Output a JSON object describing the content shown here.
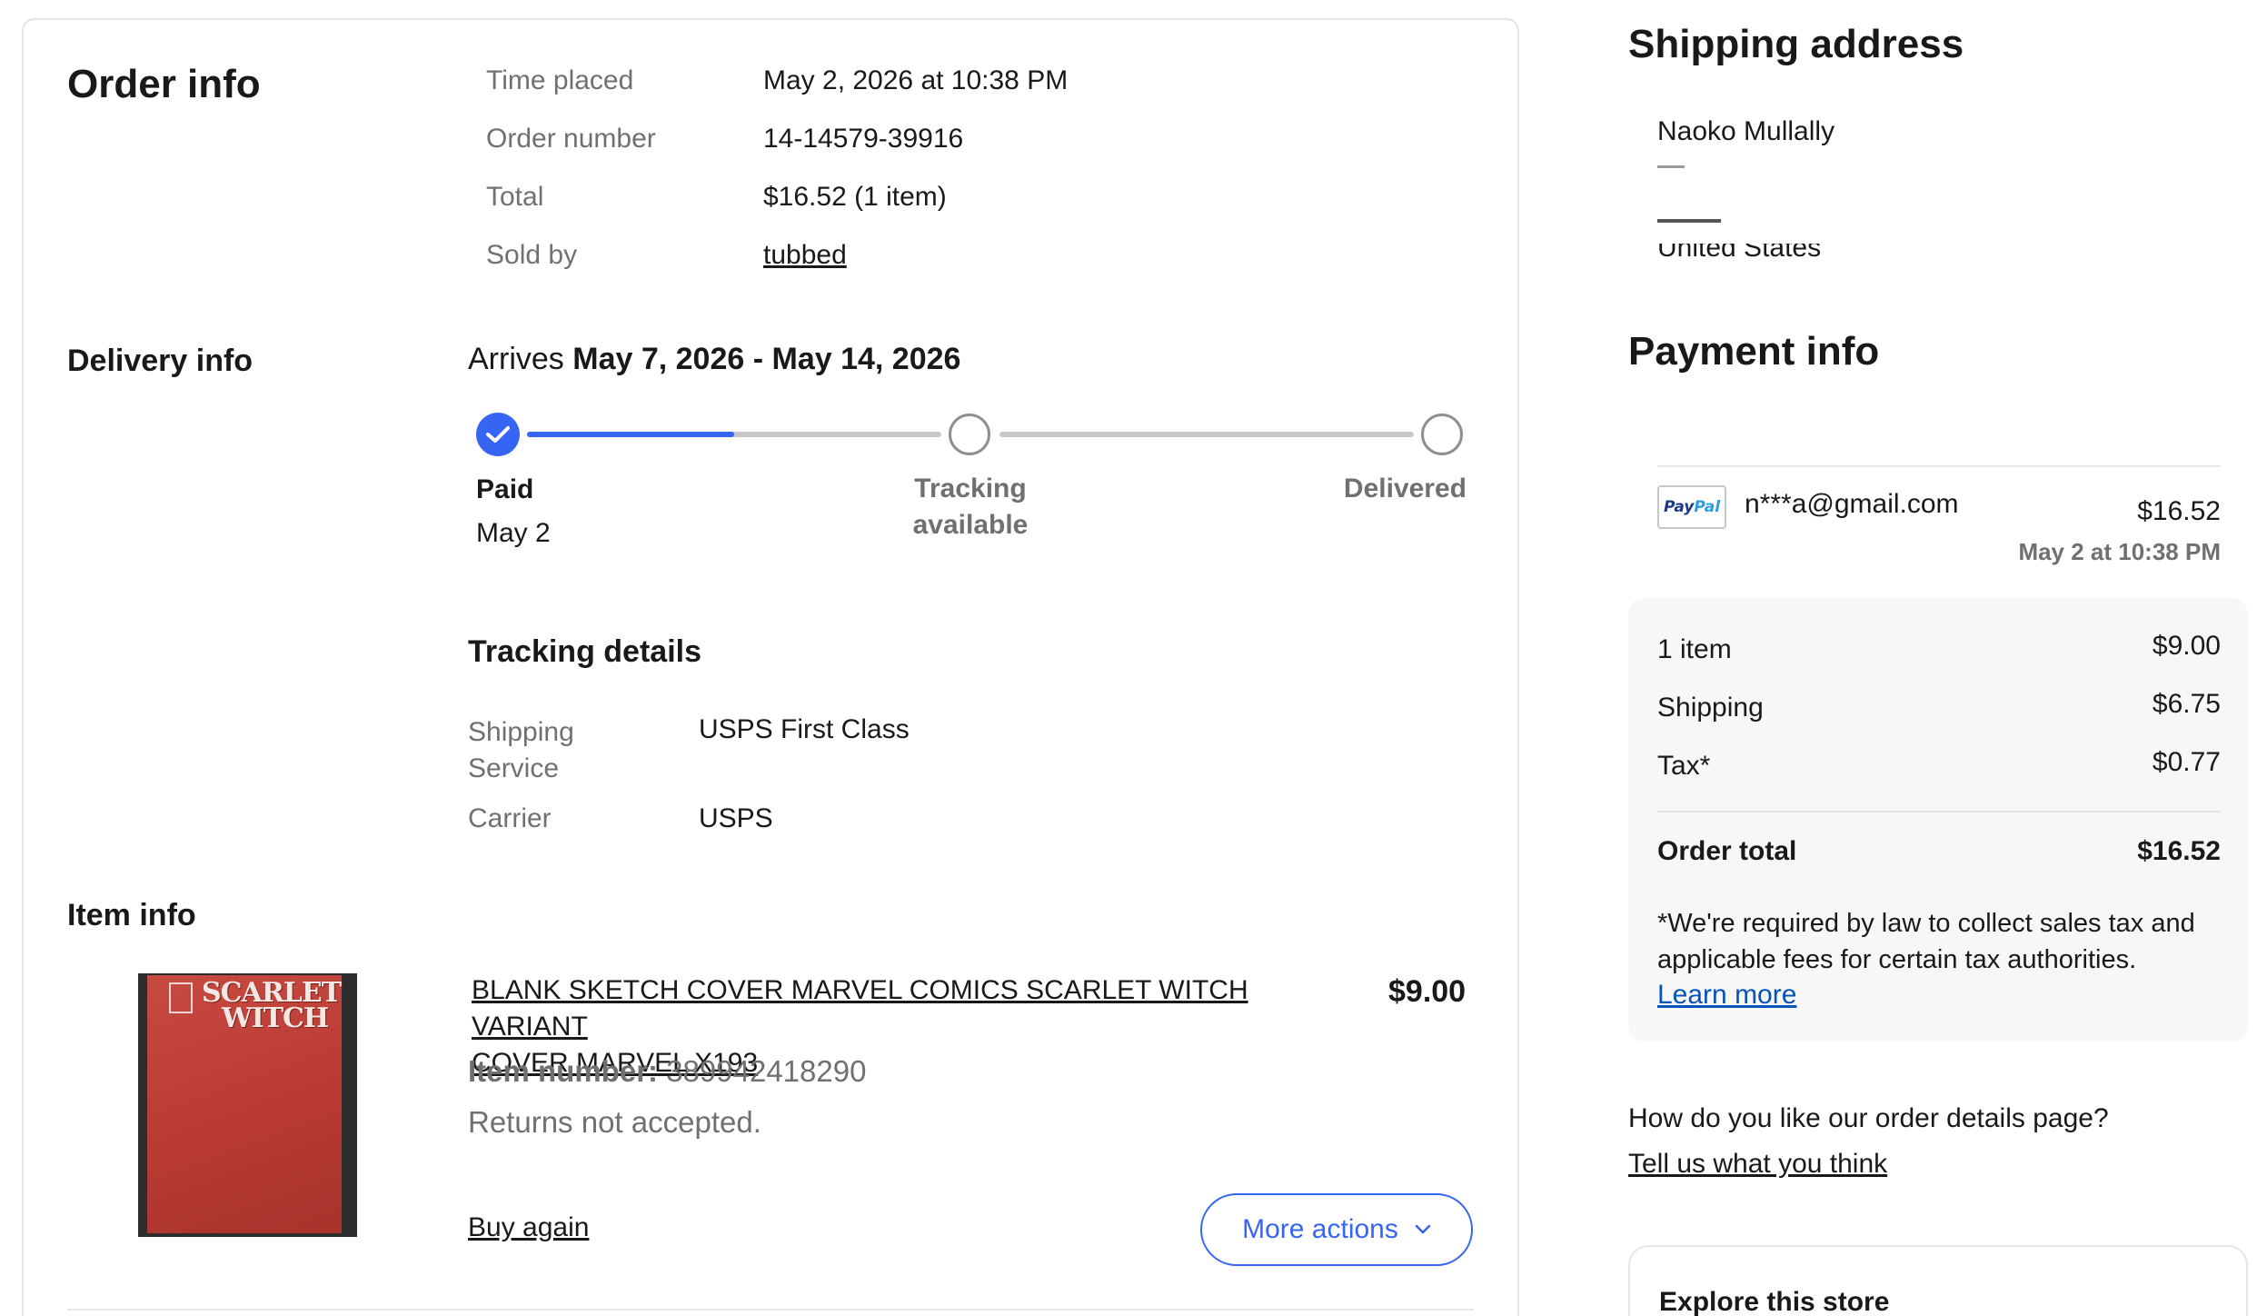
{
  "order_info": {
    "heading": "Order info",
    "rows": [
      {
        "label": "Time placed",
        "value": "May 2, 2026 at 10:38 PM"
      },
      {
        "label": "Order number",
        "value": "14-14579-39916"
      },
      {
        "label": "Total",
        "value": "$16.52 (1 item)"
      },
      {
        "label": "Sold by",
        "value": "tubbed"
      }
    ]
  },
  "delivery": {
    "heading": "Delivery info",
    "arrives_prefix": "Arrives",
    "arrives_range": "May 7, 2026 - May 14, 2026",
    "progress_fraction": 0.25,
    "steps": [
      {
        "label": "Paid",
        "sub": "May 2",
        "state": "done"
      },
      {
        "label_line1": "Tracking",
        "label_line2": "available",
        "state": "pending"
      },
      {
        "label": "Delivered",
        "state": "pending"
      }
    ]
  },
  "tracking": {
    "heading": "Tracking details",
    "service_label_line1": "Shipping",
    "service_label_line2": "Service",
    "service_value": "USPS First Class",
    "carrier_label": "Carrier",
    "carrier_value": "USPS"
  },
  "item": {
    "heading": "Item info",
    "title_line1": "BLANK SKETCH COVER MARVEL COMICS SCARLET WITCH VARIANT",
    "title_line2": "COVER MARVEL X193",
    "price": "$9.00",
    "number_label": "Item number:",
    "number_value": "389942418290",
    "returns": "Returns not accepted.",
    "buy_again": "Buy again",
    "more_actions": "More actions",
    "thumb_title_line1": "SCARLET",
    "thumb_title_line2": "WITCH"
  },
  "shipping_address": {
    "heading": "Shipping address",
    "name": "Naoko Mullally",
    "country_partial": "United States"
  },
  "payment": {
    "heading": "Payment info",
    "method_brand_a": "Pay",
    "method_brand_b": "Pal",
    "account": "n***a@gmail.com",
    "amount": "$16.52",
    "date": "May 2 at 10:38 PM"
  },
  "summary": {
    "rows": [
      {
        "label": "1 item",
        "value": "$9.00"
      },
      {
        "label": "Shipping",
        "value": "$6.75"
      },
      {
        "label": "Tax*",
        "value": "$0.77"
      }
    ],
    "total_label": "Order total",
    "total_value": "$16.52",
    "note_line1": "*We're required by law to collect sales tax and",
    "note_line2": "applicable fees for certain tax authorities.",
    "learn_more": "Learn more"
  },
  "feedback": {
    "question": "How do you like our order details page?",
    "link": "Tell us what you think"
  },
  "explore": {
    "heading": "Explore this store"
  },
  "colors": {
    "accent_blue": "#3665f3",
    "link_blue": "#0654ba",
    "muted_text": "#707070",
    "track_gray": "#c7c7c7"
  }
}
